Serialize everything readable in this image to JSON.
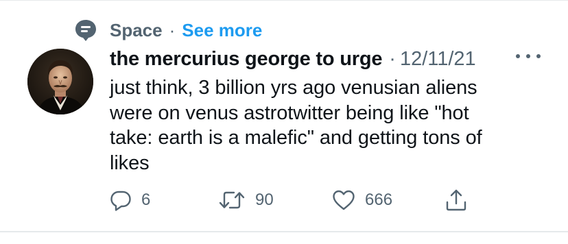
{
  "context": {
    "label": "Space",
    "separator": "·",
    "link": "See more",
    "icon": "speech-bubble-icon"
  },
  "tweet": {
    "author_name": "the mercurius george to urge",
    "separator": "·",
    "date": "12/11/21",
    "text": "just think, 3 billion yrs ago venusian aliens\nwere on venus astrotwitter being like \"hot\ntake: earth is a malefic\" and getting tons of\nlikes",
    "avatar": "portrait-avatar"
  },
  "actions": {
    "reply_count": "6",
    "retweet_count": "90",
    "like_count": "666",
    "icons": [
      "reply-icon",
      "retweet-icon",
      "like-icon",
      "share-icon"
    ]
  },
  "colors": {
    "link": "#1d9bf0",
    "secondary": "#536471",
    "text": "#0f1419",
    "divider": "#e6e9eb"
  }
}
